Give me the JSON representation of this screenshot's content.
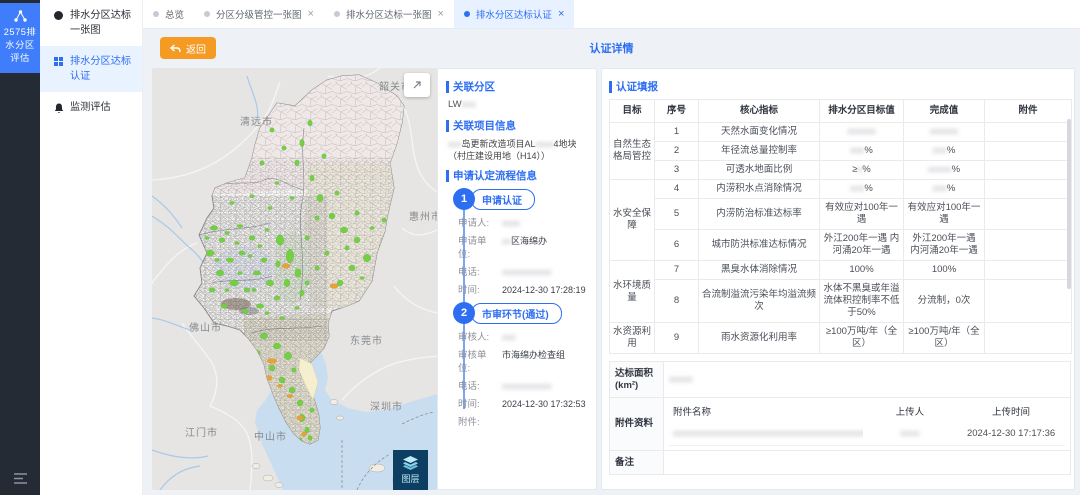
{
  "rail": {
    "active_label": "2575排水分区评估"
  },
  "menu": {
    "items": [
      {
        "label": "排水分区达标一张图",
        "icon": "circle",
        "active": false
      },
      {
        "label": "排水分区达标认证",
        "icon": "grid",
        "active": true
      },
      {
        "label": "监测评估",
        "icon": "bell",
        "active": false
      }
    ]
  },
  "tabs": [
    {
      "label": "总览",
      "closable": false,
      "active": false
    },
    {
      "label": "分区分级管控一张图",
      "closable": true,
      "active": false
    },
    {
      "label": "排水分区达标一张图",
      "closable": true,
      "active": false
    },
    {
      "label": "排水分区达标认证",
      "closable": true,
      "active": true
    }
  ],
  "toolbar": {
    "back_label": "返回"
  },
  "page_title": "认证详情",
  "map": {
    "layers_label": "图层",
    "cities": [
      "韶关市",
      "清远市",
      "惠州市",
      "佛山市",
      "东莞市",
      "深圳市",
      "中山市",
      "江门市"
    ],
    "colors": {
      "green": "#74cf45",
      "orange": "#e9a23b",
      "water": "#c9ddf0"
    }
  },
  "detail": {
    "sec_partition": "关联分区",
    "partition_prefix": "LW",
    "partition_masked": "xxx",
    "sec_project": "关联项目信息",
    "project": {
      "m1": "xxx",
      "t1": "岛更新改造项目AL",
      "m2": "xxxx",
      "t2": "4地块（村庄建设用地（H14））"
    },
    "sec_process": "申请认定流程信息",
    "steps": [
      {
        "num": "1",
        "title": "申请认证",
        "fields": [
          {
            "label": "申请人:",
            "masked": "xxxx",
            "value": ""
          },
          {
            "label": "申请单位:",
            "masked": "xx",
            "value": "区海绵办"
          },
          {
            "label": "电话:",
            "masked": "xxxxxxxxxxx",
            "value": ""
          },
          {
            "label": "时间:",
            "masked": "",
            "value": "2024-12-30 17:28:19"
          }
        ]
      },
      {
        "num": "2",
        "title": "市审环节(通过)",
        "fields": [
          {
            "label": "审核人:",
            "masked": "xxx",
            "value": ""
          },
          {
            "label": "审核单位:",
            "masked": "",
            "value": "市海绵办检查组"
          },
          {
            "label": "电话:",
            "masked": "xxxxxxxxxxx",
            "value": ""
          },
          {
            "label": "时间:",
            "masked": "",
            "value": "2024-12-30 17:32:53"
          },
          {
            "label": "附件:",
            "masked": "",
            "value": ""
          }
        ]
      }
    ]
  },
  "cert": {
    "sec_title": "认证填报",
    "headers": [
      "目标",
      "序号",
      "核心指标",
      "排水分区目标值",
      "完成值",
      "附件"
    ],
    "groups": [
      {
        "name": "自然生态格局管控",
        "rows": [
          {
            "no": "1",
            "indicator": "天然水面变化情况",
            "target": [
              {
                "m": "xxxxxx"
              }
            ],
            "done": [
              {
                "m": "xxxxxx"
              }
            ]
          },
          {
            "no": "2",
            "indicator": "年径流总量控制率",
            "target": [
              {
                "m": "xxx"
              },
              {
                "t": "%"
              }
            ],
            "done": [
              {
                "m": "xxx"
              },
              {
                "t": "%"
              }
            ]
          },
          {
            "no": "3",
            "indicator": "可透水地面比例",
            "target": [
              {
                "t": "≥"
              },
              {
                "m": "x"
              },
              {
                "t": "%"
              }
            ],
            "done": [
              {
                "m": "xxxxx"
              },
              {
                "t": "%"
              }
            ]
          }
        ]
      },
      {
        "name": "水安全保障",
        "rows": [
          {
            "no": "4",
            "indicator": "内涝积水点消除情况",
            "target": [
              {
                "m": "xxx"
              },
              {
                "t": "%"
              }
            ],
            "done": [
              {
                "m": "xxx"
              },
              {
                "t": "%"
              }
            ]
          },
          {
            "no": "5",
            "indicator": "内涝防治标准达标率",
            "target": [
              {
                "t": "有效应对100年一遇"
              }
            ],
            "done": [
              {
                "t": "有效应对100年一遇"
              }
            ]
          },
          {
            "no": "6",
            "indicator": "城市防洪标准达标情况",
            "target": [
              {
                "t": "外江200年一遇 内河涌20年一遇"
              }
            ],
            "done": [
              {
                "t": "外江200年一遇 内河涌20年一遇"
              }
            ]
          }
        ]
      },
      {
        "name": "水环境质量",
        "rows": [
          {
            "no": "7",
            "indicator": "黑臭水体消除情况",
            "target": [
              {
                "t": "100%"
              }
            ],
            "done": [
              {
                "t": "100%"
              }
            ]
          },
          {
            "no": "8",
            "indicator": "合流制溢流污染年均溢流频次",
            "target": [
              {
                "t": "水体不黑臭或年溢流体积控制率不低于50%"
              }
            ],
            "done": [
              {
                "t": "分流制，0次"
              }
            ]
          }
        ]
      },
      {
        "name": "水资源利用",
        "rows": [
          {
            "no": "9",
            "indicator": "雨水资源化利用率",
            "target": [
              {
                "t": "≥100万吨/年（全区）"
              }
            ],
            "done": [
              {
                "t": "≥100万吨/年（全区）"
              }
            ]
          }
        ]
      }
    ]
  },
  "summary": {
    "area_label": "达标面积(km²)",
    "area_masked": "xxxxx",
    "attach_label": "附件资料",
    "attach_headers": [
      "附件名称",
      "上传人",
      "上传时间"
    ],
    "attach_row": {
      "name_masked": "xxxxxxxxxxxxxxxxxxxxxxxxxxxxxxxxxxxxxxxxxxxx",
      "uploader_masked": "xxxx",
      "time": "2024-12-30 17:17:36"
    },
    "remark_label": "备注"
  }
}
